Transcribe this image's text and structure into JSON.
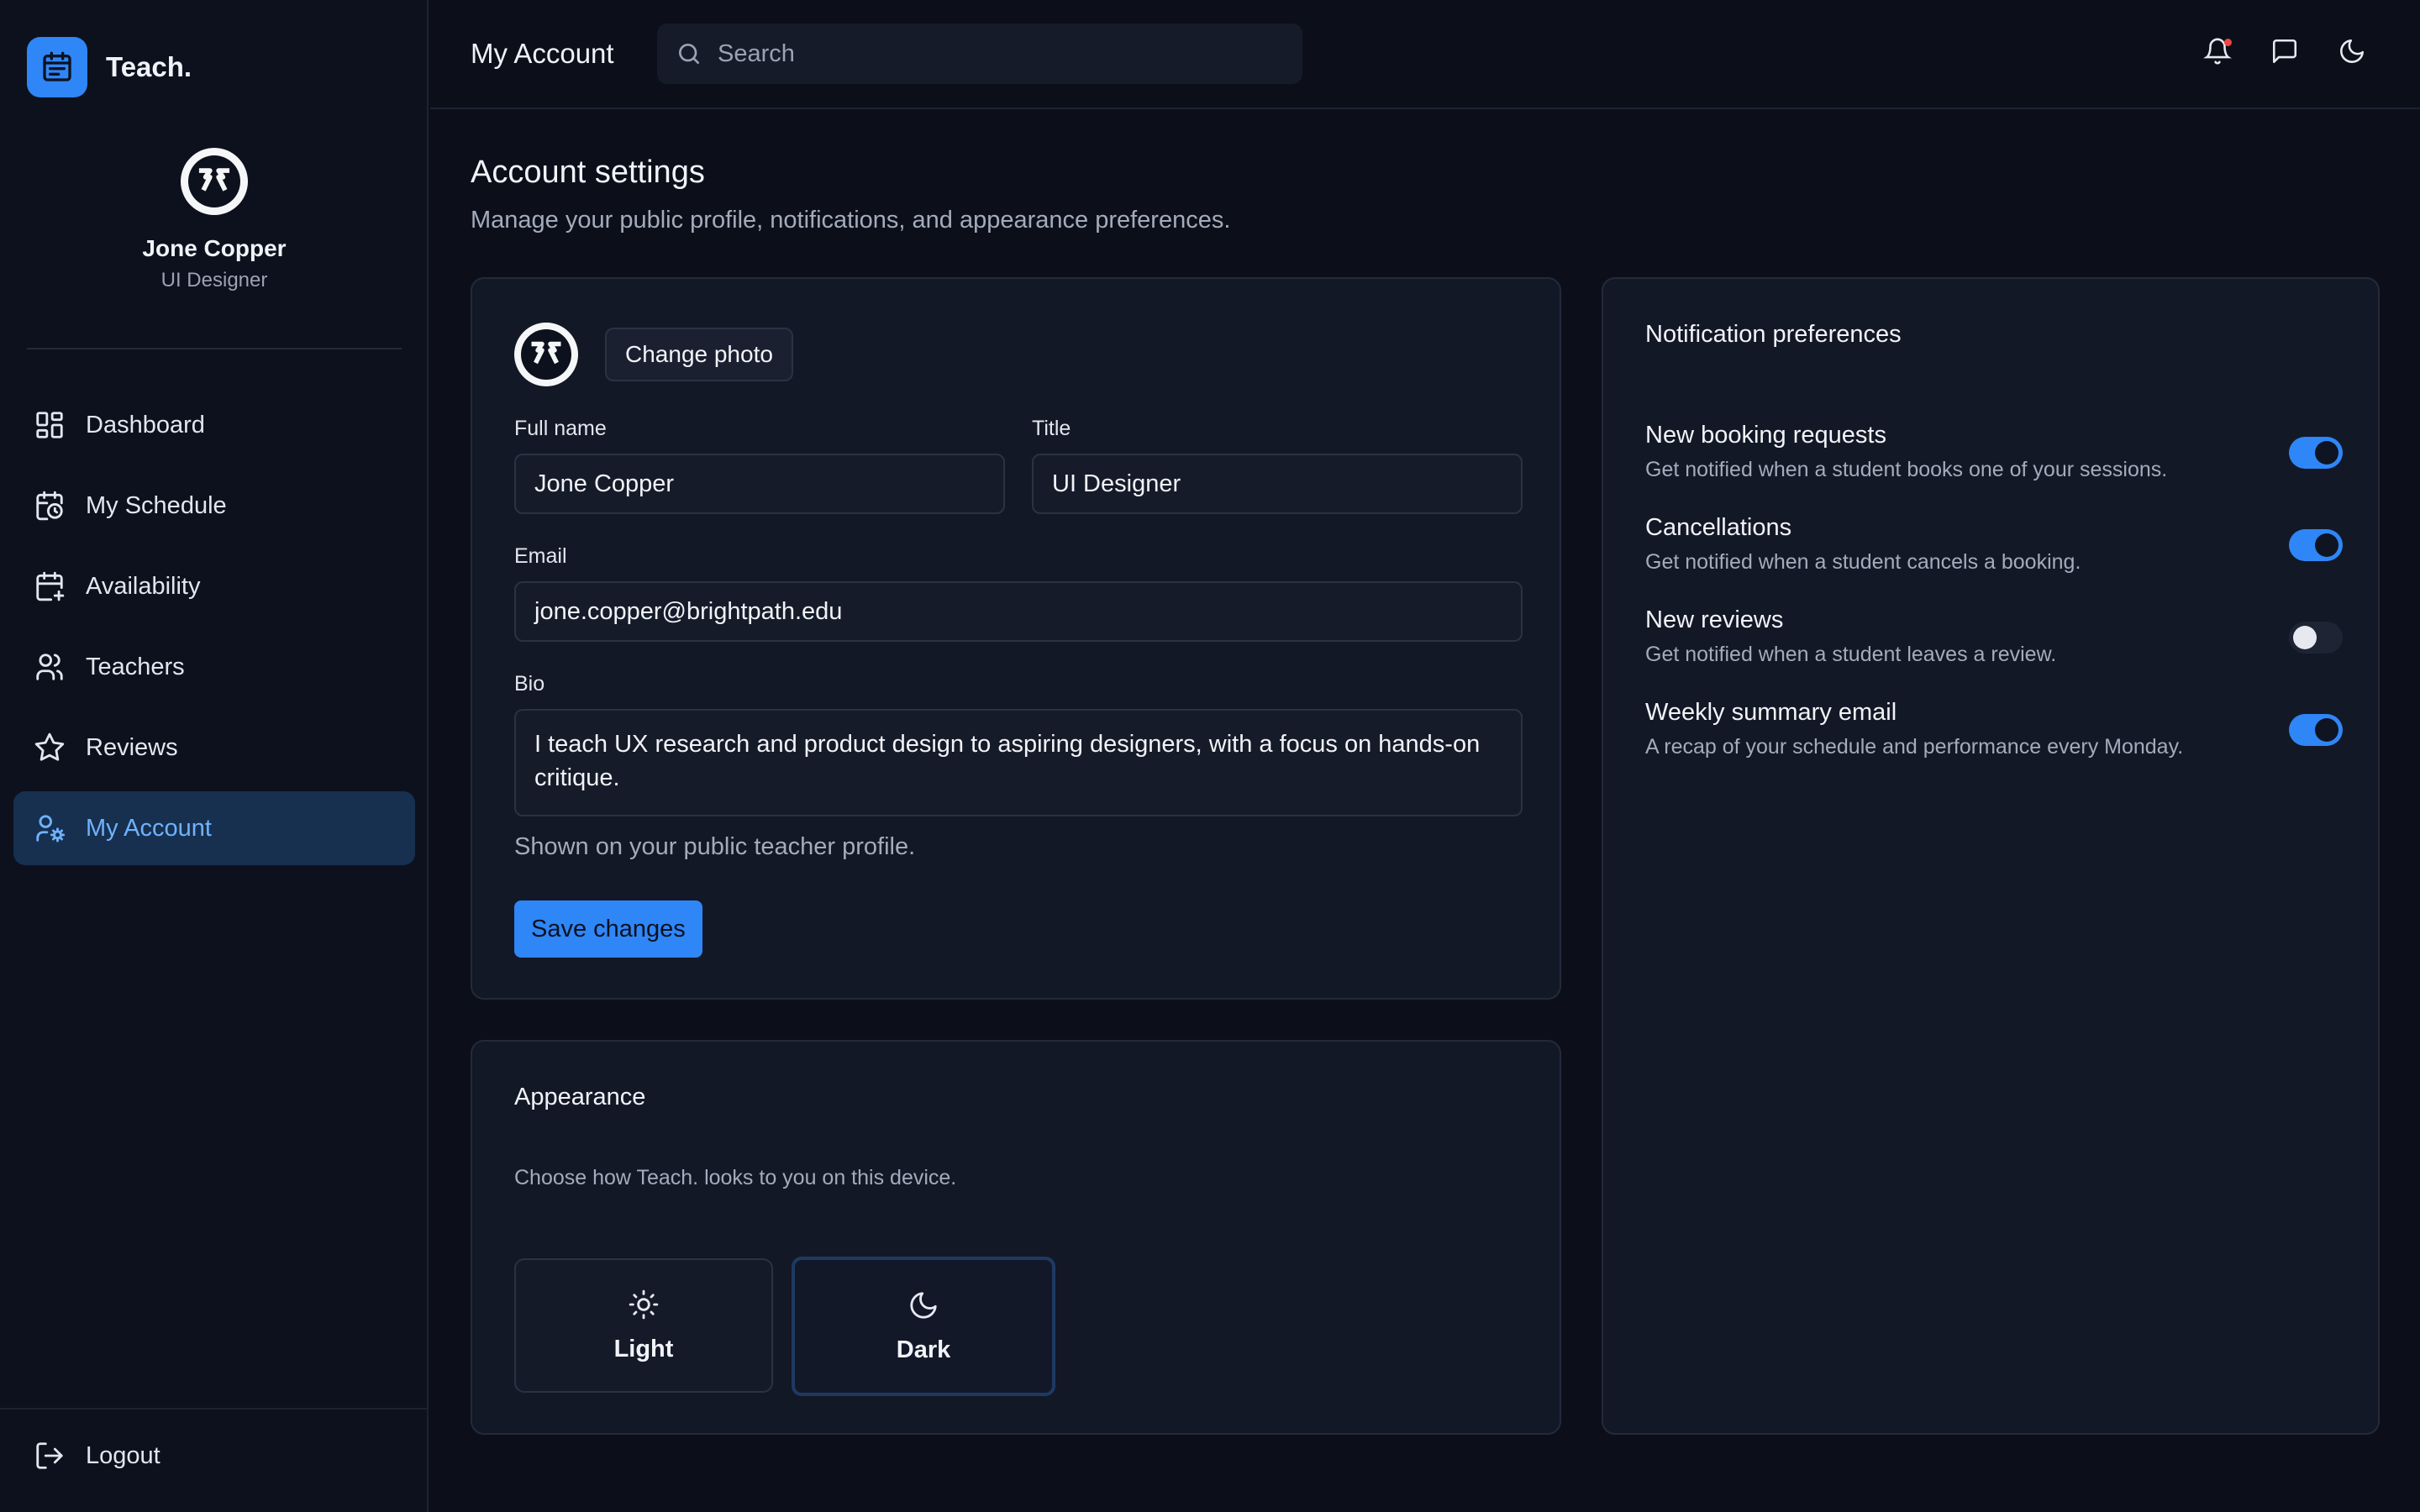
{
  "brand": {
    "name": "Teach."
  },
  "profile": {
    "name": "Jone Copper",
    "role": "UI Designer"
  },
  "sidebar": {
    "items": [
      {
        "label": "Dashboard",
        "icon": "dashboard-icon"
      },
      {
        "label": "My Schedule",
        "icon": "calendar-clock-icon"
      },
      {
        "label": "Availability",
        "icon": "calendar-plus-icon"
      },
      {
        "label": "Teachers",
        "icon": "users-icon"
      },
      {
        "label": "Reviews",
        "icon": "star-icon"
      },
      {
        "label": "My Account",
        "icon": "user-cog-icon",
        "active": true
      }
    ],
    "logout_label": "Logout"
  },
  "topbar": {
    "title": "My Account",
    "search_placeholder": "Search"
  },
  "page": {
    "heading": "Account settings",
    "subheading": "Manage your public profile, notifications, and appearance preferences."
  },
  "profile_form": {
    "change_photo_label": "Change photo",
    "full_name_label": "Full name",
    "full_name_value": "Jone Copper",
    "title_label": "Title",
    "title_value": "UI Designer",
    "email_label": "Email",
    "email_value": "jone.copper@brightpath.edu",
    "bio_label": "Bio",
    "bio_value": "I teach UX research and product design to aspiring designers, with a focus on hands-on critique.",
    "bio_helper": "Shown on your public teacher profile.",
    "save_label": "Save changes"
  },
  "appearance": {
    "title": "Appearance",
    "description": "Choose how Teach. looks to you on this device.",
    "options": [
      {
        "label": "Light",
        "icon": "sun-icon",
        "selected": false
      },
      {
        "label": "Dark",
        "icon": "moon-icon",
        "selected": true
      }
    ]
  },
  "notifications": {
    "title": "Notification preferences",
    "items": [
      {
        "title": "New booking requests",
        "description": "Get notified when a student books one of your sessions.",
        "enabled": true
      },
      {
        "title": "Cancellations",
        "description": "Get notified when a student cancels a booking.",
        "enabled": true
      },
      {
        "title": "New reviews",
        "description": "Get notified when a student leaves a review.",
        "enabled": false
      },
      {
        "title": "Weekly summary email",
        "description": "A recap of your schedule and performance every Monday.",
        "enabled": true
      }
    ]
  },
  "colors": {
    "accent": "#2f86f6",
    "background": "#0c0f1a",
    "card": "#131826",
    "active_nav": "#17304f"
  }
}
